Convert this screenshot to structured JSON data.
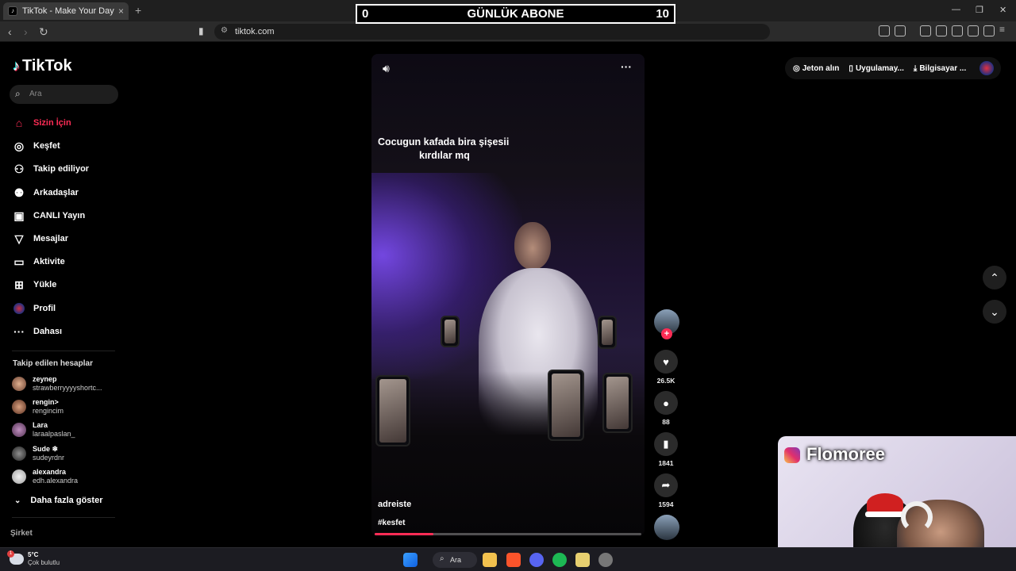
{
  "browser": {
    "tab_title": "TikTok - Make Your Day",
    "tab_close": "×",
    "new_tab": "+",
    "url": "tiktok.com",
    "window_controls": [
      "—",
      "❐",
      "✕"
    ]
  },
  "overlay": {
    "left_count": "0",
    "title": "GÜNLÜK ABONE",
    "right_count": "10"
  },
  "sidebar": {
    "logo": "TikTok",
    "search_placeholder": "Ara",
    "nav": [
      {
        "label": "Sizin İçin",
        "icon": "home-icon"
      },
      {
        "label": "Keşfet",
        "icon": "compass-icon"
      },
      {
        "label": "Takip ediliyor",
        "icon": "following-icon"
      },
      {
        "label": "Arkadaşlar",
        "icon": "friends-icon"
      },
      {
        "label": "CANLI Yayın",
        "icon": "live-icon"
      },
      {
        "label": "Mesajlar",
        "icon": "messages-icon"
      },
      {
        "label": "Aktivite",
        "icon": "activity-icon"
      },
      {
        "label": "Yükle",
        "icon": "upload-icon"
      },
      {
        "label": "Profil",
        "icon": "profile-icon"
      },
      {
        "label": "Dahası",
        "icon": "more-icon"
      }
    ],
    "following_title": "Takip edilen hesaplar",
    "following": [
      {
        "name": "zeynep",
        "handle": "strawberryyyyshortc..."
      },
      {
        "name": "rengin>",
        "handle": "rengincim"
      },
      {
        "name": "Lara",
        "handle": "laraalpaslan_"
      },
      {
        "name": "Sude ❄",
        "handle": "sudeyrdnr"
      },
      {
        "name": "alexandra",
        "handle": "edh.alexandra"
      }
    ],
    "show_more": "Daha fazla göster",
    "company": "Şirket"
  },
  "video": {
    "caption_line1": "Cocugun kafada bira şişesii",
    "caption_line2": "kırdılar mq",
    "username": "adreiste",
    "hashtag": "#kesfet",
    "progress": 0.22
  },
  "actions": {
    "likes": "26.5K",
    "comments": "88",
    "saves": "1841",
    "shares": "1594"
  },
  "topbar": {
    "coins": "Jeton alın",
    "app": "Uygulamay...",
    "pc": "Bilgisayar ..."
  },
  "webcam": {
    "name": "Flomoree"
  },
  "taskbar": {
    "temp": "5°C",
    "weather": "Çok bulutlu",
    "search": "Ara"
  },
  "colors": {
    "accent": "#fe2c55",
    "background": "#000000"
  }
}
